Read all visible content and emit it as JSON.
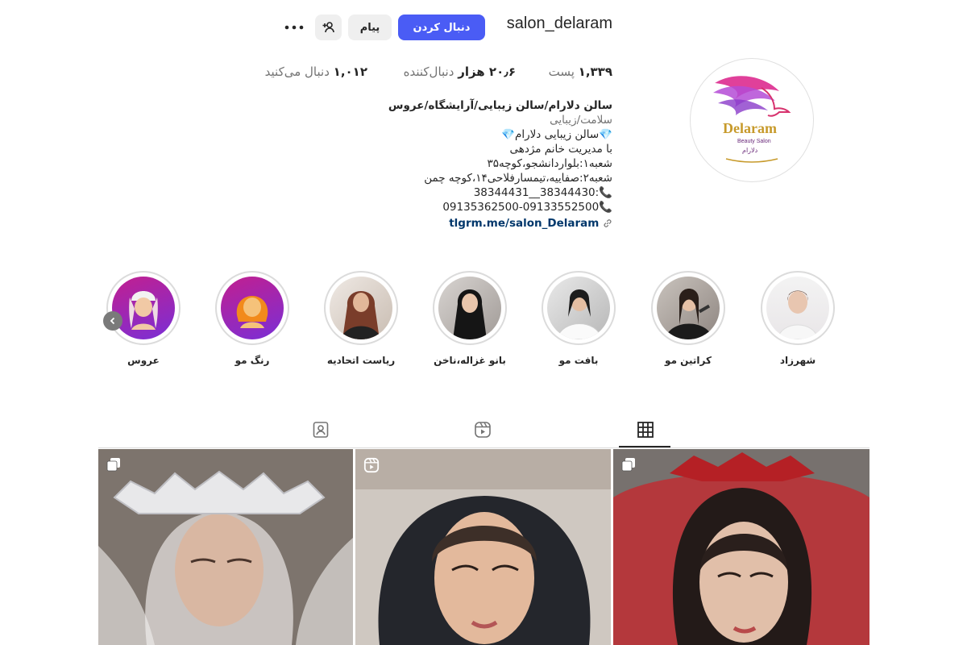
{
  "profile": {
    "username": "salon_delaram",
    "follow_label": "دنبال کردن",
    "message_label": "پیام",
    "avatar_logo_text": "Delaram",
    "avatar_logo_sub": "Beauty Salon",
    "avatar_logo_fa": "دلارام"
  },
  "stats": {
    "posts_count": "۱,۳۳۹",
    "posts_label": "پست",
    "followers_count": "۲۰٫۶ هزار",
    "followers_label": "دنبال‌کننده",
    "following_count": "۱,۰۱۲",
    "following_label": "دنبال می‌کنید"
  },
  "bio": {
    "name": "سالن دلارام/سالن زیبایی/آرایشگاه/عروس",
    "category": "سلامت/زیبایی",
    "line1": "💎سالن زیبایی دلارام💎",
    "line2": "با مدیریت خانم مژدهی",
    "line3": "شعبه۱:بلواردانشجو،کوچه۳۵",
    "line4": "شعبه۲:صفاییه،تیمسارفلاحی۱۴،کوچه چمن",
    "line5": "📞:38344430__38344431",
    "line6": "📞09135362500-09133552500",
    "link": "tlgrm.me/salon_Delaram"
  },
  "highlights": [
    {
      "label": "شهرزاد"
    },
    {
      "label": "کراتین مو"
    },
    {
      "label": "بافت مو"
    },
    {
      "label": "بانو غزاله،ناخن"
    },
    {
      "label": "ریاست اتحادیه"
    },
    {
      "label": "رنگ مو"
    },
    {
      "label": "عروس"
    }
  ],
  "tabs": [
    "grid-icon",
    "reels-icon",
    "tagged-icon"
  ],
  "colors": {
    "accent": "#4a5cf5",
    "link": "#00376b"
  }
}
